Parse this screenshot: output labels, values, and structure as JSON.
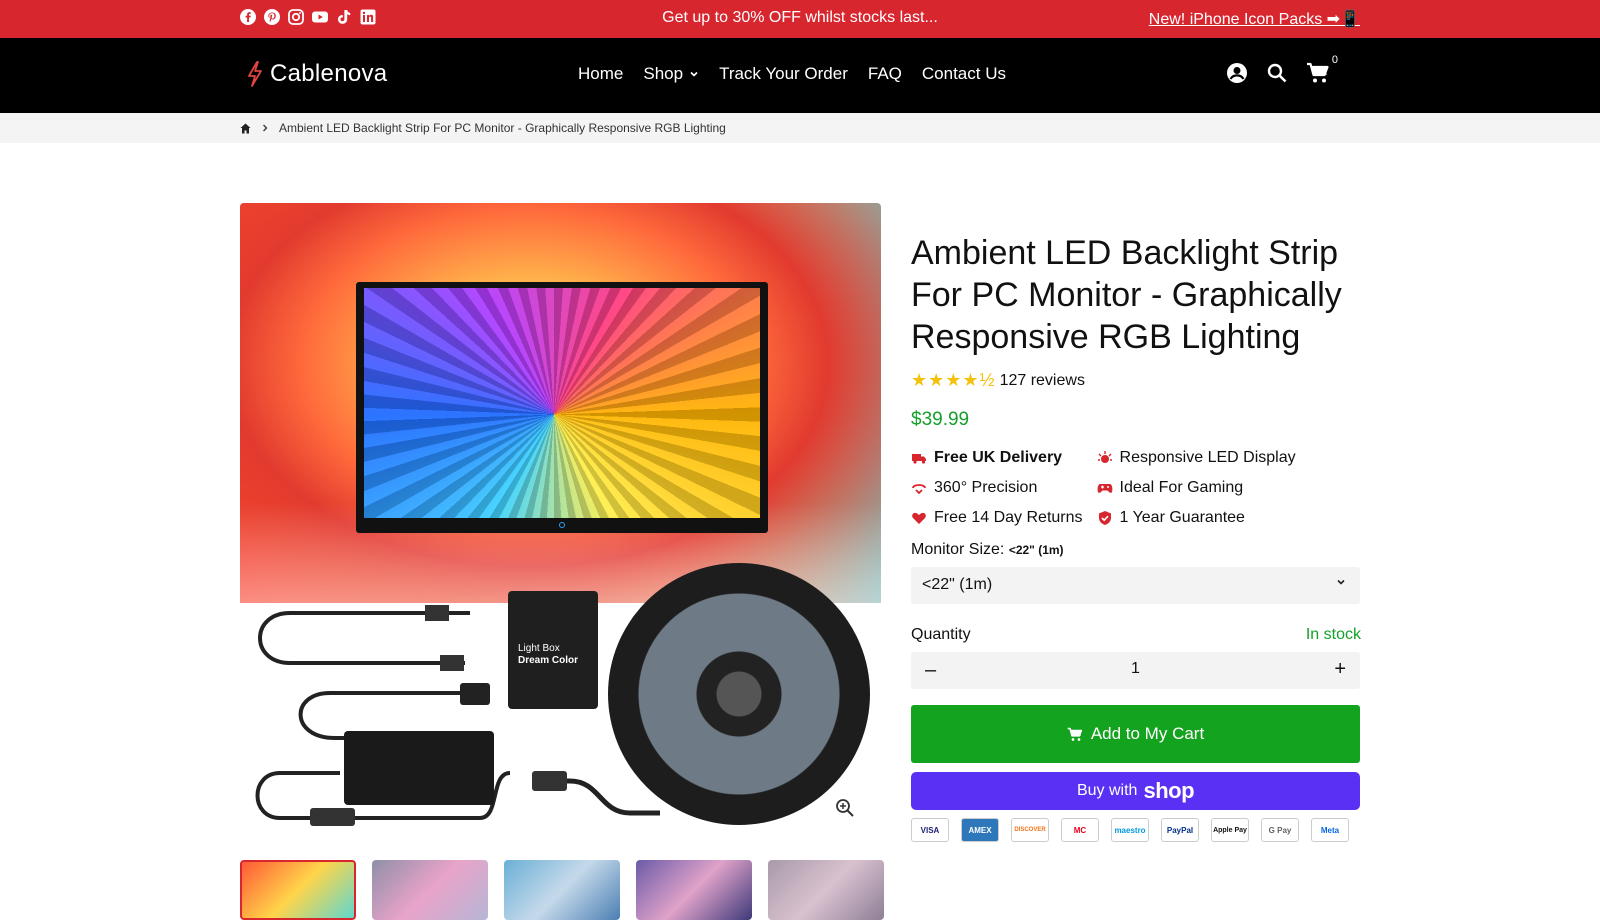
{
  "announcement": {
    "social_icons": [
      "facebook-icon",
      "pinterest-icon",
      "instagram-icon",
      "youtube-icon",
      "tiktok-icon",
      "linkedin-icon"
    ],
    "promo": "Get up to 30% OFF whilst stocks last...",
    "link": "New! iPhone Icon Packs ➡📱"
  },
  "header": {
    "logo": "Cablenova",
    "nav": [
      "Home",
      "Shop",
      "Track Your Order",
      "FAQ",
      "Contact Us"
    ],
    "cart_count": "0"
  },
  "breadcrumb": {
    "current": "Ambient LED Backlight Strip For PC Monitor - Graphically Responsive RGB Lighting"
  },
  "gallery": {
    "controller_label_line1": "Light Box",
    "controller_label_line2": "Dream Color"
  },
  "product": {
    "title": "Ambient LED Backlight Strip For PC Monitor - Graphically Responsive RGB Lighting",
    "stars": "★★★★½",
    "rating": 4.5,
    "reviews": "127 reviews",
    "price": "$39.99",
    "features": [
      {
        "icon": "truck-icon",
        "label": "Free UK Delivery",
        "bold": true
      },
      {
        "icon": "light-icon",
        "label": "Responsive LED Display",
        "bold": false
      },
      {
        "icon": "precision-icon",
        "label": "360° Precision",
        "bold": false
      },
      {
        "icon": "gamepad-icon",
        "label": "Ideal For Gaming",
        "bold": false
      },
      {
        "icon": "heart-icon",
        "label": "Free 14 Day Returns",
        "bold": false
      },
      {
        "icon": "shield-check-icon",
        "label": "1 Year Guarantee",
        "bold": false
      }
    ],
    "variant_label": "Monitor Size:",
    "variant_selected": "<22\" (1m)",
    "variant_value": "<22\" (1m)",
    "quantity_label": "Quantity",
    "stock": "In stock",
    "quantity": "1",
    "minus": "–",
    "plus": "+",
    "add_to_cart": "Add to My Cart",
    "buy_with": "Buy with",
    "shop": "shop"
  },
  "payments": [
    "VISA",
    "AMEX",
    "DISCOVER",
    "MC",
    "maestro",
    "PayPal",
    "Apple Pay",
    "G Pay",
    "Meta"
  ],
  "colors": {
    "accent": "#d8262f",
    "green": "#14a31f",
    "shop_pay": "#5a31f4"
  }
}
